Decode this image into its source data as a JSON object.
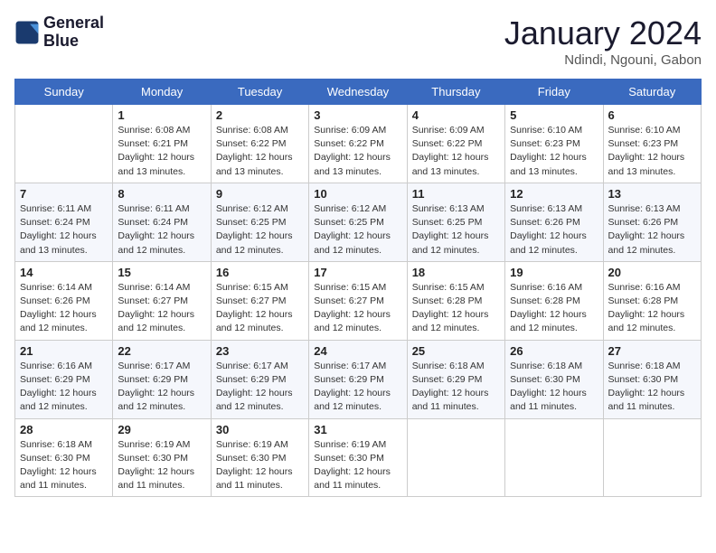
{
  "header": {
    "logo_line1": "General",
    "logo_line2": "Blue",
    "month": "January 2024",
    "location": "Ndindi, Ngouni, Gabon"
  },
  "days_of_week": [
    "Sunday",
    "Monday",
    "Tuesday",
    "Wednesday",
    "Thursday",
    "Friday",
    "Saturday"
  ],
  "weeks": [
    [
      {
        "num": "",
        "info": ""
      },
      {
        "num": "1",
        "info": "Sunrise: 6:08 AM\nSunset: 6:21 PM\nDaylight: 12 hours\nand 13 minutes."
      },
      {
        "num": "2",
        "info": "Sunrise: 6:08 AM\nSunset: 6:22 PM\nDaylight: 12 hours\nand 13 minutes."
      },
      {
        "num": "3",
        "info": "Sunrise: 6:09 AM\nSunset: 6:22 PM\nDaylight: 12 hours\nand 13 minutes."
      },
      {
        "num": "4",
        "info": "Sunrise: 6:09 AM\nSunset: 6:22 PM\nDaylight: 12 hours\nand 13 minutes."
      },
      {
        "num": "5",
        "info": "Sunrise: 6:10 AM\nSunset: 6:23 PM\nDaylight: 12 hours\nand 13 minutes."
      },
      {
        "num": "6",
        "info": "Sunrise: 6:10 AM\nSunset: 6:23 PM\nDaylight: 12 hours\nand 13 minutes."
      }
    ],
    [
      {
        "num": "7",
        "info": "Sunrise: 6:11 AM\nSunset: 6:24 PM\nDaylight: 12 hours\nand 13 minutes."
      },
      {
        "num": "8",
        "info": "Sunrise: 6:11 AM\nSunset: 6:24 PM\nDaylight: 12 hours\nand 12 minutes."
      },
      {
        "num": "9",
        "info": "Sunrise: 6:12 AM\nSunset: 6:25 PM\nDaylight: 12 hours\nand 12 minutes."
      },
      {
        "num": "10",
        "info": "Sunrise: 6:12 AM\nSunset: 6:25 PM\nDaylight: 12 hours\nand 12 minutes."
      },
      {
        "num": "11",
        "info": "Sunrise: 6:13 AM\nSunset: 6:25 PM\nDaylight: 12 hours\nand 12 minutes."
      },
      {
        "num": "12",
        "info": "Sunrise: 6:13 AM\nSunset: 6:26 PM\nDaylight: 12 hours\nand 12 minutes."
      },
      {
        "num": "13",
        "info": "Sunrise: 6:13 AM\nSunset: 6:26 PM\nDaylight: 12 hours\nand 12 minutes."
      }
    ],
    [
      {
        "num": "14",
        "info": "Sunrise: 6:14 AM\nSunset: 6:26 PM\nDaylight: 12 hours\nand 12 minutes."
      },
      {
        "num": "15",
        "info": "Sunrise: 6:14 AM\nSunset: 6:27 PM\nDaylight: 12 hours\nand 12 minutes."
      },
      {
        "num": "16",
        "info": "Sunrise: 6:15 AM\nSunset: 6:27 PM\nDaylight: 12 hours\nand 12 minutes."
      },
      {
        "num": "17",
        "info": "Sunrise: 6:15 AM\nSunset: 6:27 PM\nDaylight: 12 hours\nand 12 minutes."
      },
      {
        "num": "18",
        "info": "Sunrise: 6:15 AM\nSunset: 6:28 PM\nDaylight: 12 hours\nand 12 minutes."
      },
      {
        "num": "19",
        "info": "Sunrise: 6:16 AM\nSunset: 6:28 PM\nDaylight: 12 hours\nand 12 minutes."
      },
      {
        "num": "20",
        "info": "Sunrise: 6:16 AM\nSunset: 6:28 PM\nDaylight: 12 hours\nand 12 minutes."
      }
    ],
    [
      {
        "num": "21",
        "info": "Sunrise: 6:16 AM\nSunset: 6:29 PM\nDaylight: 12 hours\nand 12 minutes."
      },
      {
        "num": "22",
        "info": "Sunrise: 6:17 AM\nSunset: 6:29 PM\nDaylight: 12 hours\nand 12 minutes."
      },
      {
        "num": "23",
        "info": "Sunrise: 6:17 AM\nSunset: 6:29 PM\nDaylight: 12 hours\nand 12 minutes."
      },
      {
        "num": "24",
        "info": "Sunrise: 6:17 AM\nSunset: 6:29 PM\nDaylight: 12 hours\nand 12 minutes."
      },
      {
        "num": "25",
        "info": "Sunrise: 6:18 AM\nSunset: 6:29 PM\nDaylight: 12 hours\nand 11 minutes."
      },
      {
        "num": "26",
        "info": "Sunrise: 6:18 AM\nSunset: 6:30 PM\nDaylight: 12 hours\nand 11 minutes."
      },
      {
        "num": "27",
        "info": "Sunrise: 6:18 AM\nSunset: 6:30 PM\nDaylight: 12 hours\nand 11 minutes."
      }
    ],
    [
      {
        "num": "28",
        "info": "Sunrise: 6:18 AM\nSunset: 6:30 PM\nDaylight: 12 hours\nand 11 minutes."
      },
      {
        "num": "29",
        "info": "Sunrise: 6:19 AM\nSunset: 6:30 PM\nDaylight: 12 hours\nand 11 minutes."
      },
      {
        "num": "30",
        "info": "Sunrise: 6:19 AM\nSunset: 6:30 PM\nDaylight: 12 hours\nand 11 minutes."
      },
      {
        "num": "31",
        "info": "Sunrise: 6:19 AM\nSunset: 6:30 PM\nDaylight: 12 hours\nand 11 minutes."
      },
      {
        "num": "",
        "info": ""
      },
      {
        "num": "",
        "info": ""
      },
      {
        "num": "",
        "info": ""
      }
    ]
  ]
}
